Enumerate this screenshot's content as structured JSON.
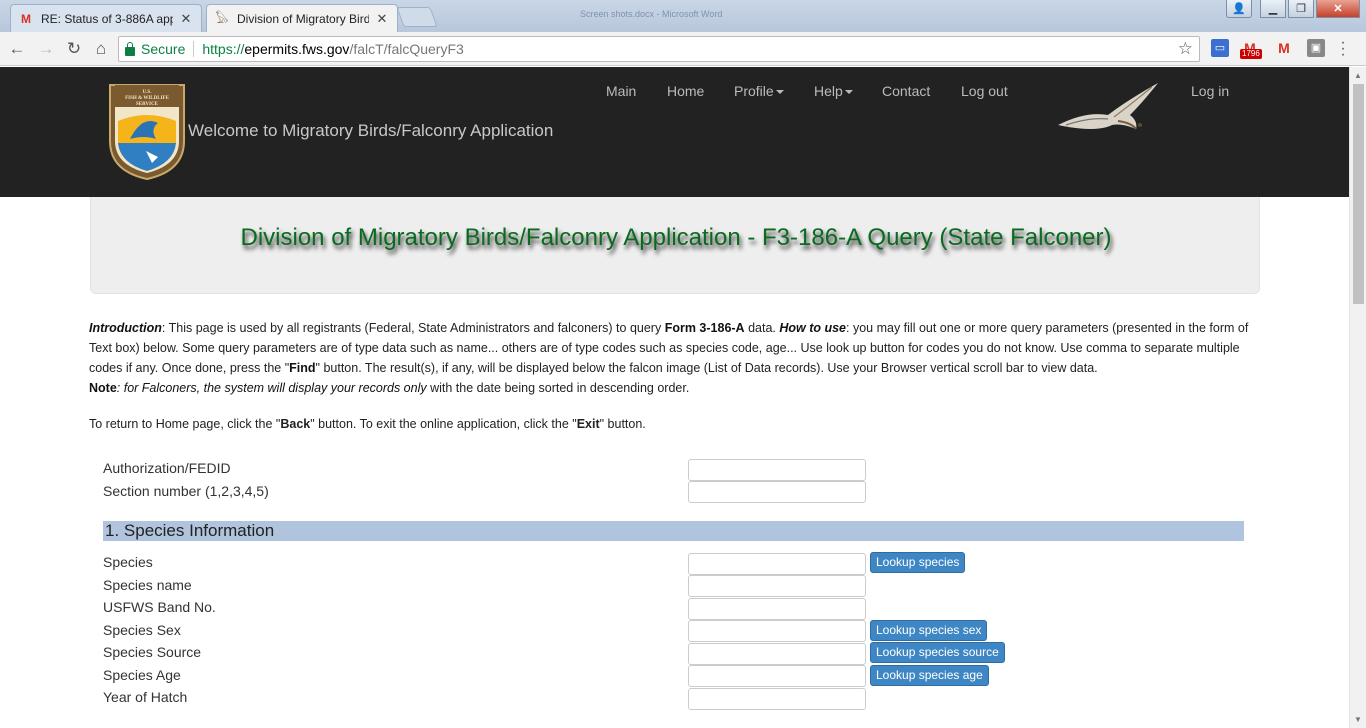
{
  "browser": {
    "tabs": [
      {
        "title": "RE: Status of 3-886A app",
        "favicon": "gmail-icon",
        "active": false
      },
      {
        "title": "Division of Migratory Birds",
        "favicon": "bird-icon",
        "active": true
      }
    ],
    "window_title": "Screen shots.docx - Microsoft Word",
    "secure_label": "Secure",
    "url_protocol": "https://",
    "url_host": "epermits.fws.gov",
    "url_path": "/falcT/falcQueryF3",
    "gmail_badge": "1796"
  },
  "header": {
    "logo_text": "U.S. FISH & WILDLIFE SERVICE",
    "welcome": "Welcome to Migratory Birds/Falconry Application",
    "nav": [
      {
        "label": "Main",
        "dropdown": false
      },
      {
        "label": "Home",
        "dropdown": false
      },
      {
        "label": "Profile",
        "dropdown": true
      },
      {
        "label": "Help",
        "dropdown": true
      },
      {
        "label": "Contact",
        "dropdown": false
      },
      {
        "label": "Log out",
        "dropdown": false
      }
    ],
    "login": "Log in"
  },
  "page": {
    "title": "Division of Migratory Birds/Falconry Application - F3-186-A Query (State Falconer)",
    "intro": {
      "intro_label": "Introduction",
      "intro_text": ": This page is used by all registrants (Federal, State Administrators and falconers) to query ",
      "form_name": "Form 3-186-A",
      "after_form": " data. ",
      "howto_label": "How to use",
      "howto_text": ": you may fill out one or more query parameters (presented in the form of Text box) below. Some query parameters are of type data such as name... others are of type codes such as species code, age... Use look up button for codes you do not know. Use comma to separate multiple codes if any. Once done, press the \"",
      "find_label": "Find",
      "find_text": "\" button. The result(s), if any, will be displayed below the falcon image (List of Data records). Use your Browser vertical scroll bar to view data.",
      "note_label": "Note",
      "note_italic": ": for Falconers, the system will display your records only",
      "note_text": " with the date being sorted in descending order."
    },
    "return_text": {
      "part1": "To return to Home page, click the \"",
      "back": "Back",
      "part2": "\" button. To exit the online application, click the \"",
      "exit": "Exit",
      "part3": "\" button."
    },
    "fields_top": [
      {
        "label": "Authorization/FEDID",
        "value": ""
      },
      {
        "label": "Section number (1,2,3,4,5)",
        "value": ""
      }
    ],
    "section1_title": "1. Species Information",
    "species_fields": [
      {
        "label": "Species",
        "value": "",
        "button": "Lookup species"
      },
      {
        "label": "Species name",
        "value": "",
        "button": ""
      },
      {
        "label": "USFWS Band No.",
        "value": "",
        "button": ""
      },
      {
        "label": "Species Sex",
        "value": "",
        "button": "Lookup species sex"
      },
      {
        "label": "Species Source",
        "value": "",
        "button": "Lookup species source"
      },
      {
        "label": "Species Age",
        "value": "",
        "button": "Lookup species age"
      },
      {
        "label": "Year of Hatch",
        "value": "",
        "button": ""
      }
    ]
  }
}
